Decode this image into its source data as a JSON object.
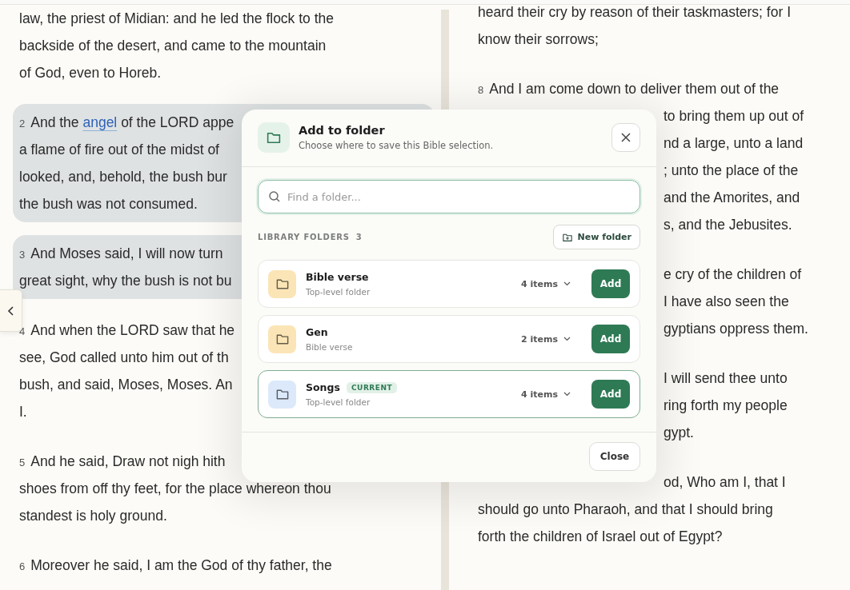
{
  "reader": {
    "left_column": [
      {
        "highlighted": false,
        "lines": [
          "law, the priest of Midian: and he led the flock to the",
          "backside of the desert, and came to the mountain",
          "of God, even to Horeb."
        ]
      },
      {
        "number": "2",
        "highlighted": true,
        "lines": [
          {
            "segments": [
              {
                "text": "And the "
              },
              {
                "text": "angel",
                "kind": "link"
              },
              {
                "text": " of the LORD appe"
              }
            ]
          },
          "a flame of fire out of the midst of",
          "looked, and, behold, the bush bur",
          "the bush was not consumed."
        ]
      },
      {
        "number": "3",
        "highlighted": true,
        "lines": [
          "And Moses said, I will now turn",
          "great sight, why the bush is not bu"
        ]
      },
      {
        "number": "4",
        "highlighted": false,
        "lines": [
          "And when the LORD saw that he",
          "see, God called unto him out of th",
          "bush, and said, Moses, Moses. An",
          "I."
        ]
      },
      {
        "number": "5",
        "highlighted": false,
        "lines": [
          "And he said, Draw not nigh hith",
          "shoes from off thy feet, for the place whereon thou",
          "standest is holy ground."
        ]
      },
      {
        "number": "6",
        "highlighted": false,
        "lines": [
          "Moreover he said, I am the God of thy father, the"
        ]
      }
    ],
    "right_column": [
      {
        "highlighted": false,
        "lines": [
          "heard their cry by reason of their taskmasters; for I",
          "know their sorrows;"
        ]
      },
      {
        "number": "8",
        "highlighted": false,
        "lines": [
          "And I am come down to deliver them out of the",
          {
            "kind": "partial",
            "text": "to bring them up out of"
          },
          {
            "kind": "partial",
            "text": "nd a large, unto a land"
          },
          {
            "kind": "partial",
            "text": "; unto the place of the"
          },
          {
            "kind": "partial",
            "text": "and the Amorites, and"
          },
          {
            "kind": "partial",
            "text": "s, and the Jebusites."
          }
        ]
      },
      {
        "highlighted": false,
        "lines": [
          {
            "kind": "partial",
            "text": "e cry of the children of"
          },
          {
            "kind": "partial",
            "text": "I have also seen the"
          },
          {
            "kind": "partial",
            "text": "gyptians oppress them."
          }
        ]
      },
      {
        "highlighted": false,
        "lines": [
          {
            "kind": "partial",
            "text": "I will send thee unto"
          },
          {
            "kind": "partial",
            "text": "ring forth my people"
          },
          {
            "kind": "partial",
            "text": "gypt."
          }
        ]
      },
      {
        "highlighted": false,
        "lines": [
          {
            "kind": "partial",
            "text": "od, Who am I, that I"
          },
          "should go unto Pharaoh, and that I should bring",
          "forth the children of Israel out of Egypt?"
        ]
      }
    ]
  },
  "dialog": {
    "title": "Add to folder",
    "subtitle": "Choose where to save this Bible selection.",
    "search": {
      "placeholder": "Find a folder..."
    },
    "section_label": "LIBRARY FOLDERS",
    "section_count": "3",
    "new_folder_button": "New folder",
    "folders": [
      {
        "name": "Bible verse",
        "subtitle": "Top-level folder",
        "count": "4 items",
        "action": "Add",
        "color": "#fbe5b6",
        "selected": false
      },
      {
        "name": "Gen",
        "subtitle": "Bible verse",
        "count": "2 items",
        "action": "Add",
        "color": "#fbe5b6",
        "selected": false
      },
      {
        "name": "Songs",
        "badge": "CURRENT",
        "subtitle": "Top-level folder",
        "count": "4 items",
        "action": "Add",
        "color": "#dce9fb",
        "selected": true
      }
    ],
    "close_button": "Close"
  }
}
